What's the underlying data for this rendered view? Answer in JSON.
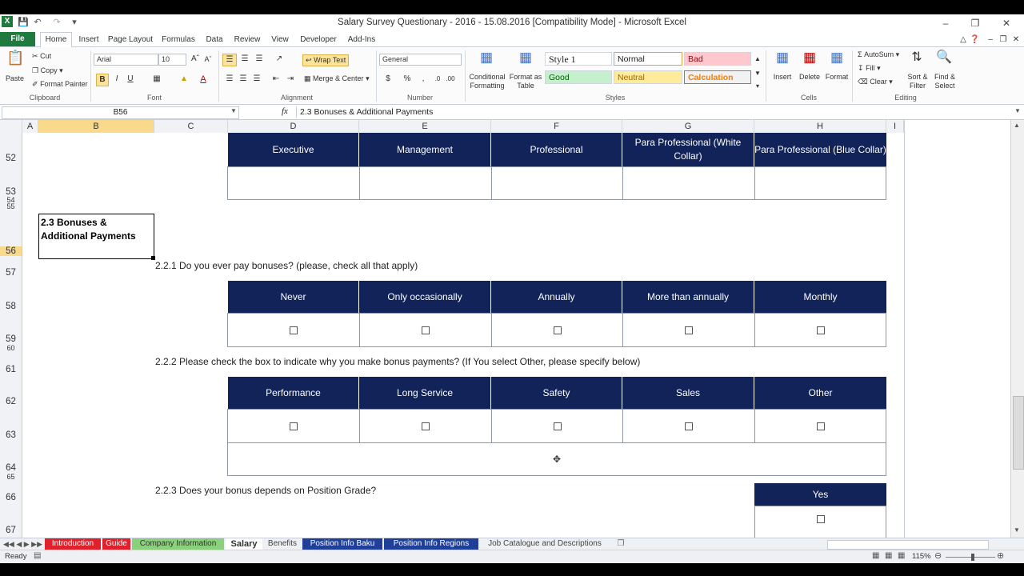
{
  "window": {
    "title": "Salary Survey Questionary - 2016 - 15.08.2016  [Compatibility Mode]  -  Microsoft Excel"
  },
  "ribbon_tabs": [
    "File",
    "Home",
    "Insert",
    "Page Layout",
    "Formulas",
    "Data",
    "Review",
    "View",
    "Developer",
    "Add-Ins"
  ],
  "clipboard": {
    "paste": "Paste",
    "cut": "Cut",
    "copy": "Copy",
    "format_painter": "Format Painter",
    "label": "Clipboard"
  },
  "font": {
    "name": "Arial",
    "size": "10",
    "label": "Font"
  },
  "alignment": {
    "wrap": "Wrap Text",
    "merge": "Merge & Center",
    "label": "Alignment"
  },
  "number": {
    "format": "General",
    "label": "Number"
  },
  "styles": {
    "conditional": "Conditional Formatting",
    "format_table": "Format as Table",
    "cells": [
      "Style 1",
      "Normal",
      "Bad",
      "Good",
      "Neutral",
      "Calculation"
    ],
    "label": "Styles"
  },
  "cells_group": {
    "insert": "Insert",
    "delete": "Delete",
    "format": "Format",
    "label": "Cells"
  },
  "editing": {
    "autosum": "AutoSum",
    "fill": "Fill",
    "clear": "Clear",
    "sort": "Sort & Filter",
    "find": "Find & Select",
    "label": "Editing"
  },
  "formula_bar": {
    "name_box": "B56",
    "fx": "fx",
    "formula": "2.3 Bonuses & Additional Payments"
  },
  "columns": [
    "A",
    "B",
    "C",
    "D",
    "E",
    "F",
    "G",
    "H",
    "I"
  ],
  "rows": {
    "r52": "52",
    "r53": "53",
    "r54": "54",
    "r55": "55",
    "r56": "56",
    "r57": "57",
    "r58": "58",
    "r59": "59",
    "r60": "60",
    "r61": "61",
    "r62": "62",
    "r63": "63",
    "r64": "64",
    "r65": "65",
    "r66": "66",
    "r67": "67"
  },
  "table1": {
    "headers": [
      "Executive",
      "Management",
      "Professional",
      "Para Professional (White Collar)",
      "Para Professional (Blue Collar)"
    ]
  },
  "section": {
    "title": "2.3 Bonuses & Additional Payments"
  },
  "q221": {
    "text": "2.2.1 Do you ever pay bonuses? (please, check all that apply)",
    "headers": [
      "Never",
      "Only occasionally",
      "Annually",
      "More than annually",
      "Monthly"
    ]
  },
  "q222": {
    "text": "2.2.2 Please check the box to indicate why you make bonus payments? (If You select Other, please specify below)",
    "headers": [
      "Performance",
      "Long Service",
      "Safety",
      "Sales",
      "Other"
    ]
  },
  "q223": {
    "text": "2.2.3 Does your bonus depends on Position Grade?",
    "headers": [
      "Yes"
    ]
  },
  "sheet_tabs": [
    "Introduction",
    "Guide",
    "Company Information",
    "Salary",
    "Benefits",
    "Position Info Baku",
    "Position Info Regions",
    "Job Catalogue and Descriptions"
  ],
  "status": {
    "ready": "Ready",
    "zoom": "115%"
  },
  "colors": {
    "header_navy": "#112359",
    "excel_green": "#1f7a3e"
  }
}
